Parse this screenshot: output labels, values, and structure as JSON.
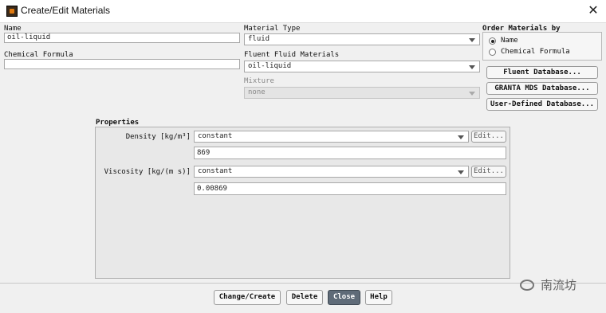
{
  "window": {
    "title": "Create/Edit Materials",
    "close_glyph": "✕"
  },
  "left": {
    "name_label": "Name",
    "name_value": "oil-liquid",
    "formula_label": "Chemical Formula",
    "formula_value": ""
  },
  "middle": {
    "material_type_label": "Material Type",
    "material_type_value": "fluid",
    "fluent_materials_label": "Fluent Fluid Materials",
    "fluent_materials_value": "oil-liquid",
    "mixture_label": "Mixture",
    "mixture_value": "none"
  },
  "order": {
    "label": "Order Materials by",
    "options": [
      "Name",
      "Chemical Formula"
    ],
    "selected": "Name"
  },
  "database_buttons": [
    "Fluent Database...",
    "GRANTA MDS Database...",
    "User-Defined Database..."
  ],
  "properties": {
    "label": "Properties",
    "rows": [
      {
        "label": "Density [kg/m³]",
        "method": "constant",
        "edit": "Edit...",
        "value": "869"
      },
      {
        "label": "Viscosity [kg/(m s)]",
        "method": "constant",
        "edit": "Edit...",
        "value": "0.00869"
      }
    ]
  },
  "footer": {
    "buttons": [
      "Change/Create",
      "Delete",
      "Close",
      "Help"
    ],
    "primary": "Close"
  },
  "watermark": {
    "text": "南流坊",
    "icon": "wechat-icon"
  },
  "colors": {
    "primary_button": "#5f6b78",
    "disabled_field": "#e4e4e4"
  }
}
